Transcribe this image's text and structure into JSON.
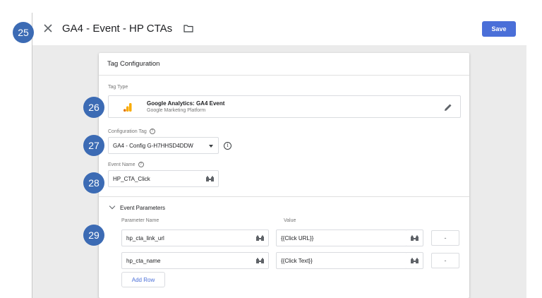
{
  "badges": [
    "25",
    "26",
    "27",
    "28",
    "29"
  ],
  "header": {
    "title": "GA4 - Event - HP CTAs",
    "save_label": "Save"
  },
  "card": {
    "title": "Tag Configuration",
    "tag_type": {
      "label": "Tag Type",
      "name": "Google Analytics: GA4 Event",
      "vendor": "Google Marketing Platform"
    },
    "config_tag": {
      "label": "Configuration Tag",
      "selected": "GA4 - Config G-H7HHSD4DDW"
    },
    "event_name": {
      "label": "Event Name",
      "value": "HP_CTA_Click"
    },
    "event_parameters": {
      "section_label": "Event Parameters",
      "col_name_header": "Parameter Name",
      "col_value_header": "Value",
      "rows": [
        {
          "name": "hp_cta_link_url",
          "value": "{{Click URL}}",
          "remove": "-"
        },
        {
          "name": "hp_cta_name",
          "value": "{{Click Text}}",
          "remove": "-"
        }
      ],
      "add_row_label": "Add Row"
    }
  },
  "colors": {
    "badge": "#3c6bb4",
    "save_button": "#4a6fd8",
    "canvas": "#ebebeb",
    "ga_orange": "#f9ab00",
    "ga_dark_orange": "#e37400"
  },
  "icons": [
    "close-icon",
    "folder-icon",
    "ga-logo-icon",
    "pencil-icon",
    "help-icon",
    "info-icon",
    "variable-icon",
    "chevron-down-icon"
  ]
}
